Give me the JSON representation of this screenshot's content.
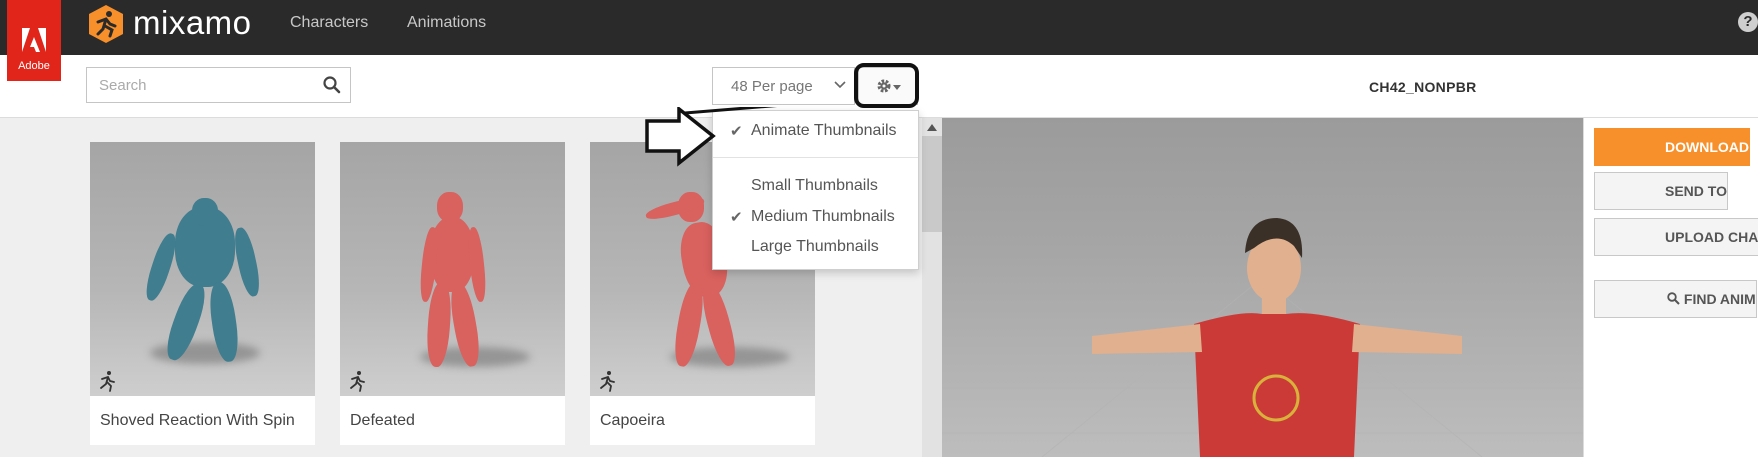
{
  "header": {
    "adobe_label": "Adobe",
    "brand": "mixamo",
    "nav": [
      "Characters",
      "Animations"
    ],
    "help_label": "?"
  },
  "toolbar": {
    "search_placeholder": "Search",
    "per_page": "48 Per page"
  },
  "settings_menu": {
    "items": [
      {
        "label": "Animate Thumbnails",
        "checked": true
      },
      {
        "label": "Small Thumbnails",
        "checked": false
      },
      {
        "label": "Medium Thumbnails",
        "checked": true
      },
      {
        "label": "Large Thumbnails",
        "checked": false
      }
    ],
    "check_glyph": "✔"
  },
  "animations": [
    {
      "name": "Shoved Reaction With Spin",
      "color": "#3f7d8f"
    },
    {
      "name": "Defeated",
      "color": "#d9615e"
    },
    {
      "name": "Capoeira",
      "color": "#d9615e"
    }
  ],
  "viewer": {
    "character_name": "CH42_NONPBR"
  },
  "side_buttons": [
    "DOWNLOAD",
    "SEND TO",
    "UPLOAD CHA",
    "FIND ANIM"
  ],
  "colors": {
    "accent": "#f7902b",
    "adobe_red": "#e1251b",
    "topbar": "#2a2a2a"
  }
}
